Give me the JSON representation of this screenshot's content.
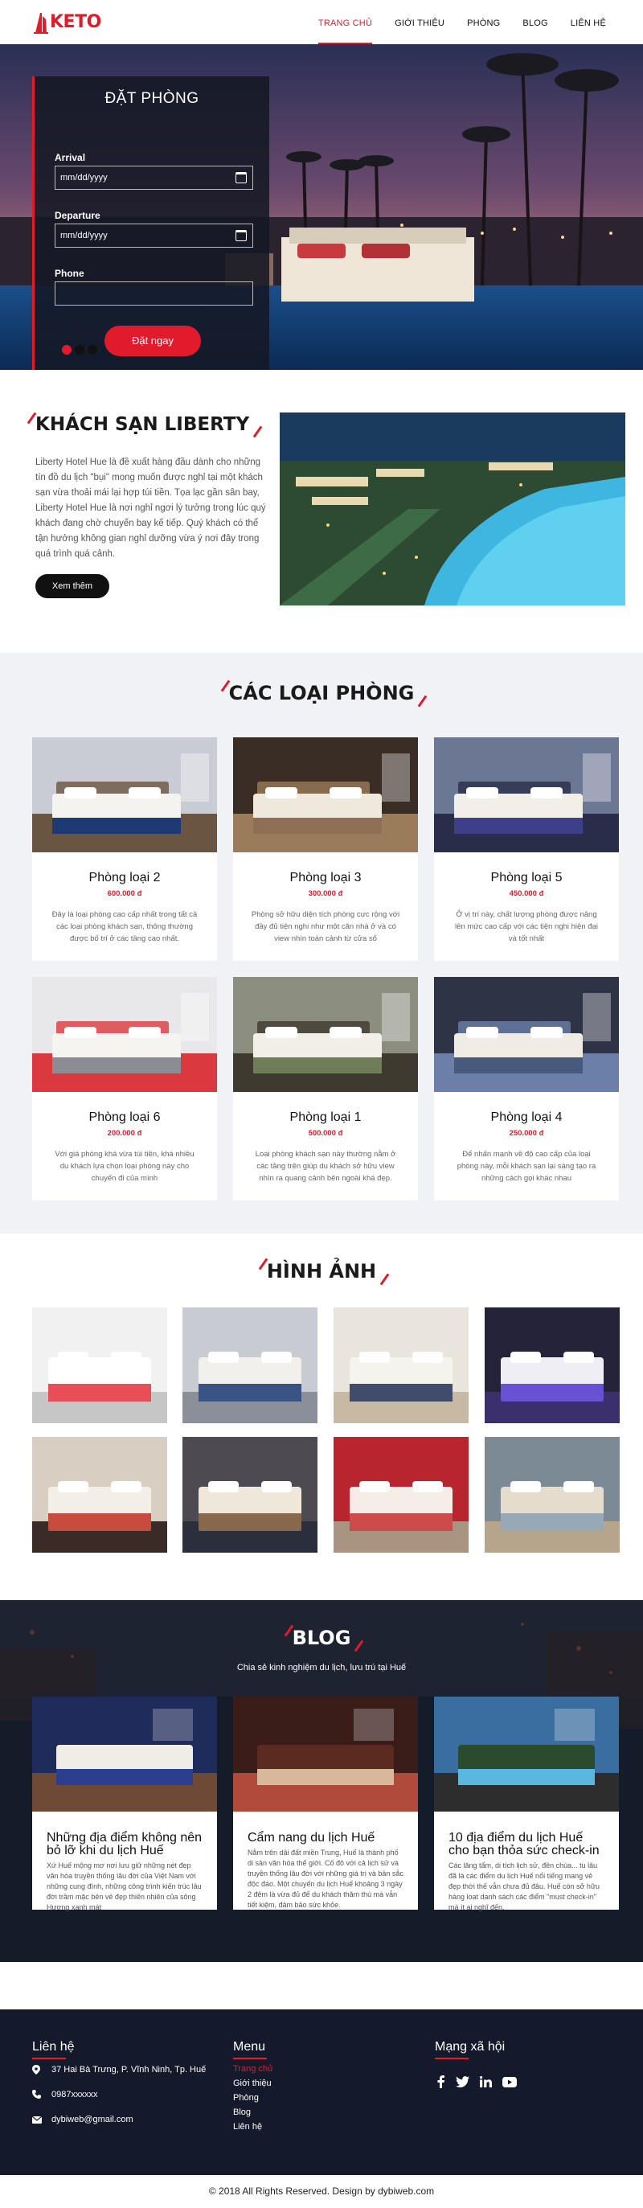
{
  "brand": {
    "name": "KETO",
    "accent": "#e11b2b"
  },
  "nav": [
    {
      "label": "TRANG CHỦ",
      "active": true
    },
    {
      "label": "GIỚI THIỆU"
    },
    {
      "label": "PHÒNG"
    },
    {
      "label": "BLOG"
    },
    {
      "label": "LIÊN HỆ"
    }
  ],
  "booking": {
    "title": "ĐẶT PHÒNG",
    "arrival_label": "Arrival",
    "arrival_value": "mm/dd/yyyy",
    "departure_label": "Departure",
    "departure_value": "mm/dd/yyyy",
    "phone_label": "Phone",
    "phone_value": "",
    "submit": "Đặt ngay"
  },
  "slider": {
    "count": 3,
    "active": 1
  },
  "about": {
    "title": "KHÁCH SẠN LIBERTY",
    "text": "Liberty Hotel Hue là đề xuất hàng đầu dành cho những tín đồ du lịch \"bụi\" mong muốn được nghỉ tại một khách sạn vừa thoải mái lại hợp túi tiền. Tọa lạc gần sân bay, Liberty Hotel Hue là nơi nghỉ ngơi lý tưởng trong lúc quý khách đang chờ chuyến bay kế tiếp. Quý khách có thể tận hưởng không gian nghỉ dưỡng vừa ý nơi đây trong quá trình quá cảnh.",
    "button": "Xem thêm"
  },
  "rooms": {
    "title": "CÁC LOẠI PHÒNG",
    "items": [
      {
        "name": "Phòng loại 2",
        "price": "600.000 đ",
        "desc": "Đây là loại phòng cao cấp nhất trong tất cả các loại phòng khách sạn, thông thường được bố trí ở các tầng cao nhất."
      },
      {
        "name": "Phòng loại 3",
        "price": "300.000 đ",
        "desc": "Phòng sở hữu diện tích phòng cực rộng với đầy đủ tiện nghi như một căn nhà ở và có view nhìn toàn cảnh từ cửa sổ"
      },
      {
        "name": "Phòng loại 5",
        "price": "450.000 đ",
        "desc": "Ở vị trí này, chất lượng phòng được nâng lên mức cao cấp với các tiện nghi hiện đại và tốt nhất"
      },
      {
        "name": "Phòng loại 6",
        "price": "200.000 đ",
        "desc": "Với giá phòng khá vừa túi tiền, khá nhiều du khách lựa chọn loại phòng này cho chuyến đi của mình"
      },
      {
        "name": "Phòng loại 1",
        "price": "500.000 đ",
        "desc": "Loại phòng khách sạn này thường nằm ở các tầng trên giúp du khách sở hữu view nhìn ra quang cảnh bên ngoài khá đẹp."
      },
      {
        "name": "Phòng loại 4",
        "price": "250.000 đ",
        "desc": "Để nhấn mạnh về độ cao cấp của loại phòng này, mỗi khách sạn lại sáng tạo ra những cách gọi khác nhau"
      }
    ]
  },
  "gallery": {
    "title": "HÌNH ẢNH"
  },
  "blog": {
    "title": "BLOG",
    "subtitle": "Chia sẻ kinh nghiệm du lịch, lưu trú tại Huế",
    "posts": [
      {
        "title": "Những địa điểm không nên bỏ lỡ khi du lịch Huế",
        "desc": "Xứ Huế mộng mơ nơi lưu giữ những nét đẹp văn hóa truyền thống lâu đời của Việt Nam với những cung đình, những công trình kiến trúc lâu đời trầm mặc bên vẻ đẹp thiên nhiên của sông Hương xanh mát"
      },
      {
        "title": "Cẩm nang du lịch Huế",
        "desc": "Nằm trên dải đất miền Trung, Huế là thành phố di sản văn hóa thế giới. Cố đô với cả lịch sử và truyền thống lâu đời với những giá trị và bản sắc độc đáo. Một chuyến du lịch Huế khoảng 3 ngày 2 đêm là vừa đủ để du khách thăm thú mà vẫn tiết kiệm, đảm bảo sức khỏe."
      },
      {
        "title": "10 địa điểm du lịch Huế cho bạn thỏa sức check-in",
        "desc": "Các lăng tẩm, di tích lịch sử, đền chùa... tu lâu đã là các điểm du lịch Huế nổi tiếng mang vẻ đẹp thời thế vẫn chưa đủ đâu. Huế còn sở hữu hàng loạt danh sách các điểm \"must check-in\" mà ít ai nghĩ đến."
      }
    ]
  },
  "footer": {
    "contact_title": "Liên hệ",
    "address": "37 Hai Bà Trưng, P. Vĩnh Ninh, Tp. Huế",
    "phone": "0987xxxxxx",
    "email": "dybiweb@gmail.com",
    "menu_title": "Menu",
    "menu": [
      "Trang chủ",
      "Giới thiệu",
      "Phòng",
      "Blog",
      "Liên hệ"
    ],
    "social_title": "Mạng xã hội",
    "social_icons": [
      "facebook-icon",
      "twitter-icon",
      "linkedin-icon",
      "youtube-icon"
    ],
    "copyright": "© 2018 All Rights Reserved. Design by dybiweb.com"
  }
}
